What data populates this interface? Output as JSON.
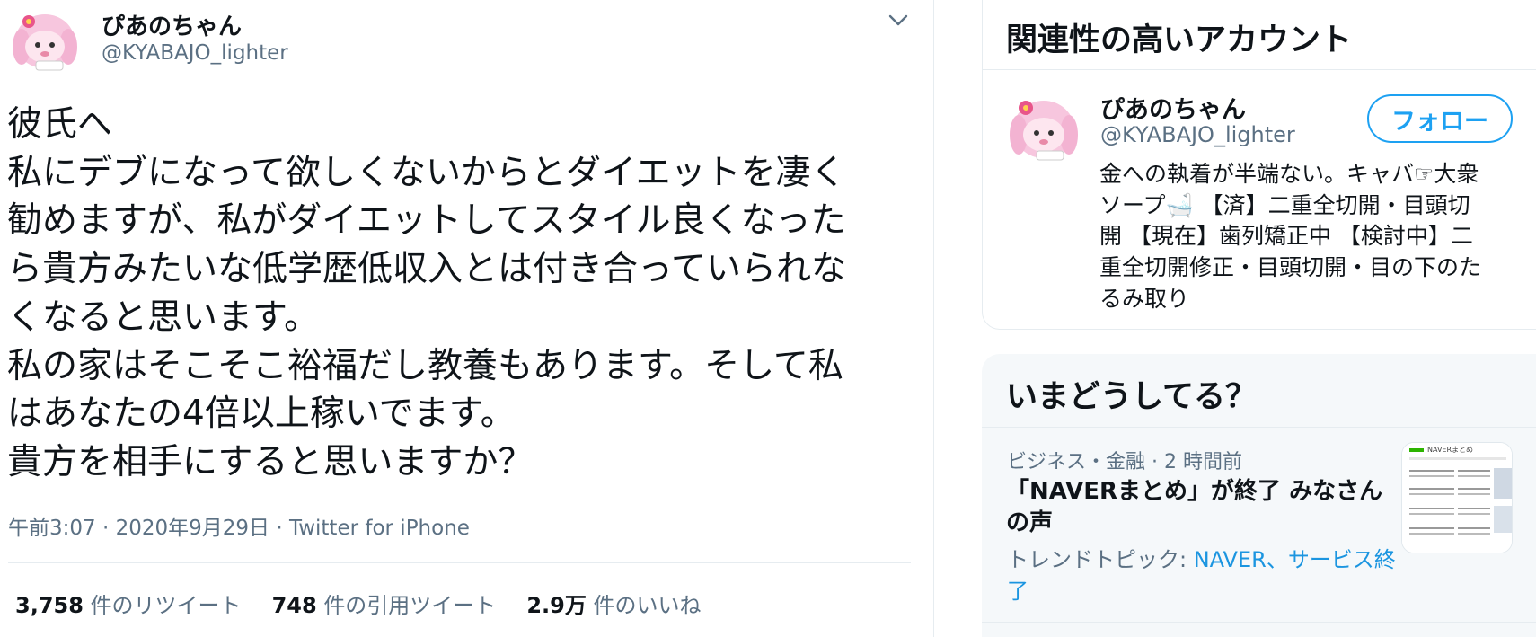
{
  "tweet": {
    "author_name": "ぴあのちゃん",
    "author_handle": "@KYABAJO_lighter",
    "body_lines": [
      "彼氏へ",
      "私にデブになって欲しくないからとダイエットを凄く",
      "勧めますが、私がダイエットしてスタイル良くなった",
      "ら貴方みたいな低学歴低収入とは付き合っていられな",
      "くなると思います。",
      "私の家はそこそこ裕福だし教養もあります。そして私",
      "はあなたの4倍以上稼いでます。",
      "貴方を相手にすると思いますか？"
    ],
    "time": "午前3:07",
    "date": "2020年9月29日",
    "source": "Twitter for iPhone",
    "separator": " · ",
    "stats": [
      {
        "count": "3,758",
        "label": "件のリツイート"
      },
      {
        "count": "748",
        "label": "件の引用ツイート"
      },
      {
        "count": "2.9万",
        "label": "件のいいね"
      }
    ],
    "menu_icon": "chevron-down-icon"
  },
  "related": {
    "title": "関連性の高いアカウント",
    "account": {
      "name": "ぴあのちゃん",
      "handle": "@KYABAJO_lighter",
      "follow_label": "フォロー",
      "bio_lines": [
        "金への執着が半端ない。キャバ☞大衆",
        "ソープ🛁 【済】二重全切開・目頭切",
        "開 【現在】歯列矯正中 【検討中】二",
        "重全切開修正・目頭切開・目の下のた",
        "るみ取り"
      ]
    }
  },
  "trends": {
    "title": "いまどうしてる？",
    "item": {
      "meta": "ビジネス・金融 · 2 時間前",
      "headline_lines": [
        "「NAVERまとめ」が終了 みなさん",
        "の声"
      ],
      "topic_prefix": "トレンドトピック: ",
      "topic_link_1": "NAVER",
      "topic_sep": "、",
      "topic_link_2a": "サービス終",
      "topic_link_2b": "了",
      "thumb_brand": "NAVERまとめ"
    }
  },
  "colors": {
    "accent": "#1da1f2",
    "link": "#1b95e0",
    "secondary_text": "#5b7083",
    "border": "#e6ecf0",
    "panel_bg": "#f5f8fa"
  }
}
